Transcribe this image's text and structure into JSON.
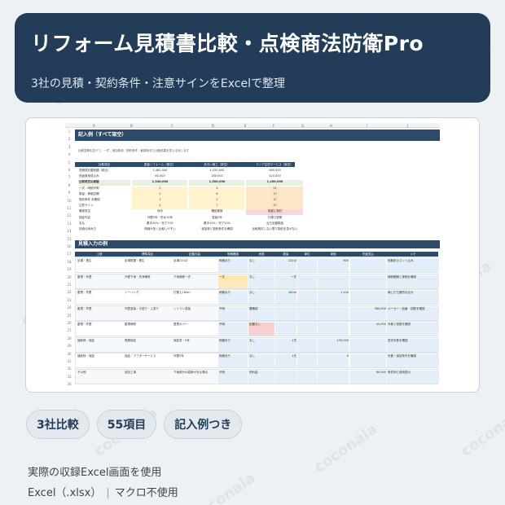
{
  "header": {
    "title": "リフォーム見積書比較・点検商法防衛Pro",
    "subtitle": "3社の見積・契約条件・注意サインをExcelで整理"
  },
  "watermark_text": "coconala",
  "sheet": {
    "columns": [
      "A",
      "B",
      "C",
      "D",
      "E",
      "F",
      "G",
      "H",
      "I",
      "J"
    ],
    "section1_title": "記入例（すべて架空）",
    "section1_note": "比較見積を並べて、一式・追加費用・契約条件・勧誘状況で比較結果を見える化します",
    "table1_headers": [
      "比較項目",
      "塗装リフォーム（架空）",
      "あおい施工（架空）",
      "クリア住宅サービス（架空）"
    ],
    "table1_rows": [
      [
        "見積書記載総額（税込）",
        "1,480,000",
        "1,320,000",
        "980,000"
      ],
      [
        "別途費用見込み",
        "60,000",
        "180,000",
        "420,000"
      ],
      [
        "比較用支払総額",
        "1,540,000",
        "1,500,000",
        "1,400,000"
      ],
      [
        "一式・明細不明",
        "2",
        "4",
        "11"
      ],
      [
        "数量・単価空欄",
        "2",
        "6",
        "17"
      ],
      [
        "契約条件 未確認",
        "1",
        "2",
        "17"
      ],
      [
        "注意サイン",
        "2",
        "7",
        "27"
      ],
      [
        "確認書生",
        "良め",
        "確認推奨",
        "慎重に検討"
      ],
      [
        "保証内容",
        "外壁5年・防水10年",
        "塗装5年",
        "口頭で説明"
      ],
      [
        "支払",
        "着手30%・完了70%",
        "着手50%・完了50%",
        "当日全額現金"
      ],
      [
        "評価の読み方",
        "明細が多く比較しやすい",
        "追加費と契約条件を確認",
        "比較検討しない限り契約を急がない"
      ]
    ],
    "section2_title": "見積入力の例",
    "table2_headers": [
      "工程",
      "標準項目",
      "記載内容",
      "明細確認",
      "状態",
      "数量",
      "単位",
      "単価",
      "別途見込",
      "メモ"
    ],
    "table2_rows": [
      [
        "足場・養生",
        "足場設置・養生",
        "足場220㎡",
        "明細あり",
        "なし",
        "220㎡",
        "",
        "900",
        "",
        "飛散防止ネット込み"
      ],
      [
        "屋根・外壁",
        "外壁下地・洗浄補修",
        "下地補修一式",
        "一式",
        "なし",
        "一式",
        "",
        "",
        "",
        "補修範囲と単価を確認"
      ],
      [
        "屋根・外壁",
        "シーリング",
        "打替え180m",
        "明細あり",
        "なし",
        "180m",
        "",
        "1,100",
        "",
        "増し打ち箇所を区分"
      ],
      [
        "屋根・外壁",
        "外壁塗装・中塗り・上塗り",
        "シリコン塗装",
        "不明",
        "要確認",
        "",
        "",
        "",
        "380,000",
        "メーカー・品番・回数を確認"
      ],
      [
        "屋根・外壁",
        "屋根補修",
        "屋根カバー",
        "不明",
        "記載なし",
        "",
        "",
        "",
        "40,000",
        "対象と枚数を確認"
      ],
      [
        "諸経費・保証",
        "長期保証",
        "保証書・5年",
        "明細あり",
        "なし",
        "1式",
        "",
        "135,000",
        "",
        "書式対象を確認"
      ],
      [
        "諸経費・保証",
        "保証・アフターサービス",
        "外壁5年",
        "明細あり",
        "なし",
        "1式",
        "",
        "0",
        "",
        "対象・保証条件を確認"
      ],
      [
        "その他",
        "追加工事",
        "下地部分の腐食がある場合",
        "不明",
        "別料金",
        "",
        "",
        "",
        "80,000",
        "条件別に費用表示"
      ]
    ]
  },
  "pills": [
    "3社比較",
    "55項目",
    "記入例つき"
  ],
  "footer": {
    "line1": "実際の収録Excel画面を使用",
    "line2a": "Excel（.xlsx）",
    "line2b": "マクロ不使用"
  }
}
